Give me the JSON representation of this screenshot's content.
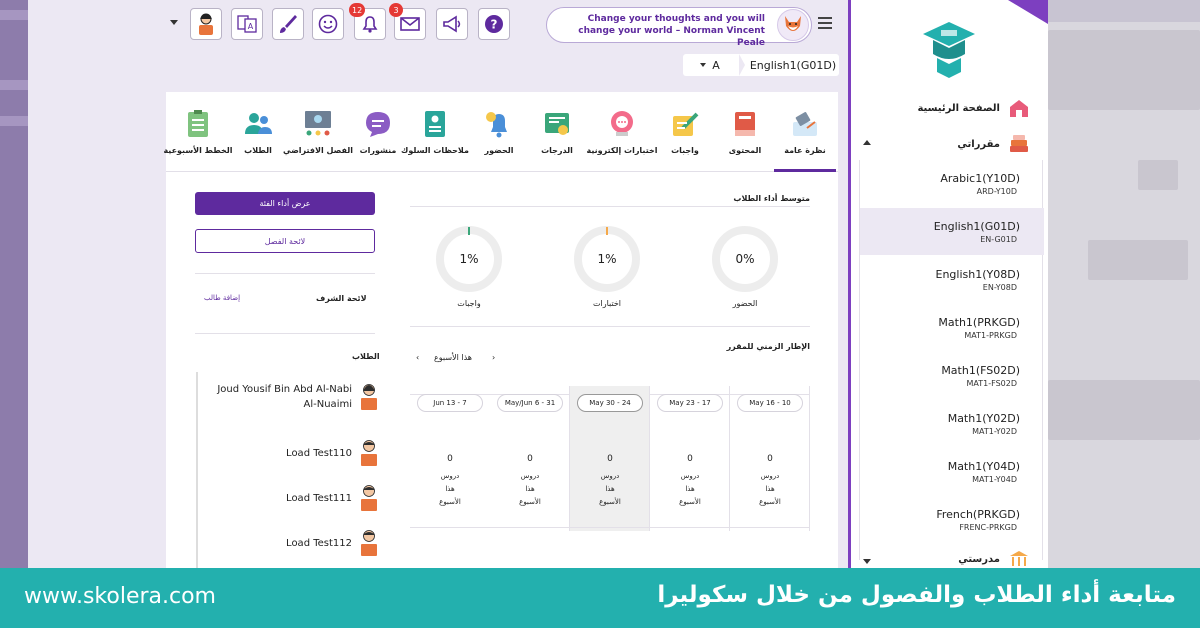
{
  "header": {
    "quote": "Change your thoughts and you will change your world – Norman Vincent Peale",
    "notifications_count": "12",
    "messages_count": "3",
    "icons": [
      "student-avatar-icon",
      "translate-icon",
      "brush-icon",
      "smiley-icon",
      "bell-icon",
      "mail-icon",
      "megaphone-icon",
      "help-icon"
    ]
  },
  "selector": {
    "section": "A",
    "course": "English1(G01D)"
  },
  "tabs": [
    {
      "label": "نظرة عامة",
      "icon": "overview-icon"
    },
    {
      "label": "المحتوى",
      "icon": "book-icon"
    },
    {
      "label": "واجبات",
      "icon": "homework-icon"
    },
    {
      "label": "اختبارات إلكترونية",
      "icon": "quiz-icon"
    },
    {
      "label": "الدرجات",
      "icon": "certificate-icon"
    },
    {
      "label": "الحضور",
      "icon": "attendance-bell-icon"
    },
    {
      "label": "ملاحظات السلوك",
      "icon": "behavior-notes-icon"
    },
    {
      "label": "منشورات",
      "icon": "chat-icon"
    },
    {
      "label": "الفصل الافتراضي",
      "icon": "virtual-class-icon"
    },
    {
      "label": "الطلاب",
      "icon": "students-icon"
    },
    {
      "label": "الخطط الأسبوعية",
      "icon": "weekly-plan-icon"
    }
  ],
  "left_panel": {
    "view_class_performance": "عرض أداء الفئة",
    "class_rules": "لائحة الفصل",
    "supervisors_title": "لائحة الشرف",
    "add_student": "إضافة طالب",
    "students_title": "الطلاب",
    "students": [
      "Joud Yousif Bin Abd Al-Nabi Al-Nuaimi",
      "Load Test110",
      "Load Test111",
      "Load Test112"
    ]
  },
  "performance": {
    "title": "متوسط أداء الطلاب",
    "gauges": [
      {
        "label": "الحضور",
        "value": "0%",
        "fraction": 0.0
      },
      {
        "label": "اختبارات",
        "value": "1%",
        "fraction": 0.01
      },
      {
        "label": "واجبات",
        "value": "1%",
        "fraction": 0.01
      }
    ]
  },
  "timeline": {
    "title": "الإطار الزمني للمقرر",
    "nav_label": "هذا الأسبوع",
    "prev_symbol": "‹",
    "next_symbol": "›",
    "weeks": [
      {
        "range": "May 16 - 10",
        "lessons": "0",
        "t1": "دروس",
        "t2": "هذا",
        "t3": "الأسبوع"
      },
      {
        "range": "May 23 - 17",
        "lessons": "0",
        "t1": "دروس",
        "t2": "هذا",
        "t3": "الأسبوع"
      },
      {
        "range": "May 30 - 24",
        "lessons": "0",
        "t1": "دروس",
        "t2": "هذا",
        "t3": "الأسبوع"
      },
      {
        "range": "May/Jun 6 - 31",
        "lessons": "0",
        "t1": "دروس",
        "t2": "هذا",
        "t3": "الأسبوع"
      },
      {
        "range": "Jun 13 - 7",
        "lessons": "0",
        "t1": "دروس",
        "t2": "هذا",
        "t3": "الأسبوع"
      }
    ]
  },
  "sidebar": {
    "home": "الصفحة الرئيسية",
    "my_courses": "مقرراتي",
    "my_school": "مدرستي",
    "courses": [
      {
        "name": "Arabic1(Y10D)",
        "code": "ARD-Y10D"
      },
      {
        "name": "English1(G01D)",
        "code": "EN-G01D"
      },
      {
        "name": "English1(Y08D)",
        "code": "EN-Y08D"
      },
      {
        "name": "Math1(PRKGD)",
        "code": "MAT1-PRKGD"
      },
      {
        "name": "Math1(FS02D)",
        "code": "MAT1-FS02D"
      },
      {
        "name": "Math1(Y02D)",
        "code": "MAT1-Y02D"
      },
      {
        "name": "Math1(Y04D)",
        "code": "MAT1-Y04D"
      },
      {
        "name": "French(PRKGD)",
        "code": "FRENC-PRKGD"
      }
    ]
  },
  "banner": {
    "url": "www.skolera.com",
    "title": "متابعة أداء الطلاب والفصول من خلال سكوليرا"
  },
  "colors": {
    "primary": "#5e2a9e",
    "accent": "#7d3fc0",
    "banner": "#23b0ae",
    "badge": "#e53935"
  }
}
